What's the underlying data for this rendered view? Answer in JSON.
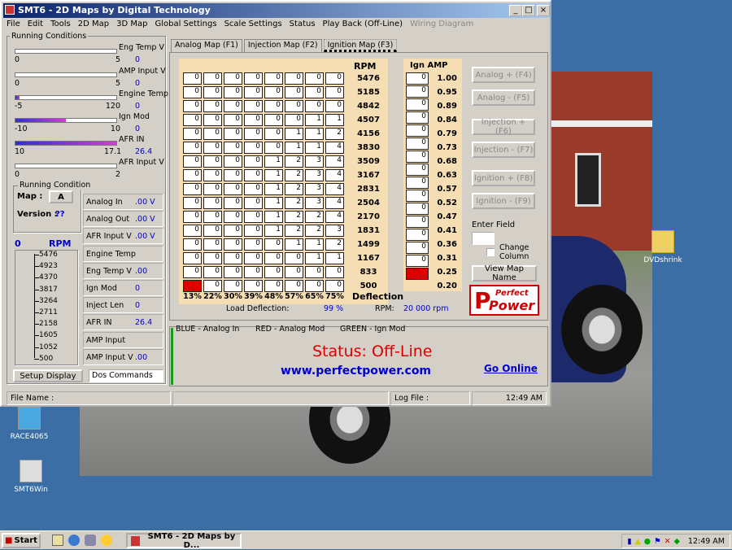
{
  "window": {
    "title": "SMT6 - 2D Maps  by Digital Technology"
  },
  "menu": [
    "File",
    "Edit",
    "Tools",
    "2D Map",
    "3D Map",
    "Global Settings",
    "Scale Settings",
    "Status",
    "Play Back (Off-Line)",
    "Wiring Diagram"
  ],
  "running_conditions": {
    "title": "Running Conditions",
    "gauges": [
      {
        "label": "Eng Temp V",
        "min": "0",
        "max": "5",
        "value": "0",
        "fill": 0
      },
      {
        "label": "AMP Input V",
        "min": "0",
        "max": "5",
        "value": "0",
        "fill": 0
      },
      {
        "label": "Engine Temp",
        "min": "-5",
        "max": "120",
        "value": "0",
        "fill": 0.04
      },
      {
        "label": "Ign Mod",
        "min": "-10",
        "max": "10",
        "value": "0",
        "fill": 0.5
      },
      {
        "label": "AFR IN",
        "min": "10",
        "max": "17.1",
        "value": "26.4",
        "fill": 1
      },
      {
        "label": "AFR Input V",
        "min": "0",
        "max": "2",
        "value": "",
        "fill": 0
      }
    ]
  },
  "running_condition": {
    "title": "Running Condition",
    "map_label": "Map :",
    "map_value": "A",
    "version_label": "Version :",
    "version_value": "??"
  },
  "readouts": [
    {
      "label": "Analog In",
      "value": ".00 V"
    },
    {
      "label": "Analog Out",
      "value": ".00 V"
    },
    {
      "label": "AFR Input V",
      "value": ".00 V"
    },
    {
      "label": "Engine Temp",
      "value": ""
    },
    {
      "label": "Eng Temp V",
      "value": ".00"
    },
    {
      "label": "Ign Mod",
      "value": "0"
    },
    {
      "label": "Inject Len",
      "value": "0"
    },
    {
      "label": "AFR IN",
      "value": "26.4"
    },
    {
      "label": "AMP Input",
      "value": ""
    },
    {
      "label": "AMP Input V",
      "value": ".00"
    }
  ],
  "rpm_gauge": {
    "value": "0",
    "label": "RPM",
    "ticks": [
      "5476",
      "4923",
      "4370",
      "3817",
      "3264",
      "2711",
      "2158",
      "1605",
      "1052",
      "500"
    ]
  },
  "setup_button": "Setup Display",
  "dos_commands": "Dos Commands",
  "tabs": [
    "Analog Map (F1)",
    "Injection Map (F2)",
    "Ignition Map (F3)"
  ],
  "map": {
    "rpm_header": "RPM",
    "amp_header": "Ign AMP",
    "rpm": [
      "5476",
      "5185",
      "4842",
      "4507",
      "4156",
      "3830",
      "3509",
      "3167",
      "2831",
      "2504",
      "2170",
      "1831",
      "1499",
      "1167",
      "833",
      "500"
    ],
    "amp": [
      "1.00",
      "0.95",
      "0.89",
      "0.84",
      "0.79",
      "0.73",
      "0.68",
      "0.63",
      "0.57",
      "0.52",
      "0.47",
      "0.41",
      "0.36",
      "0.31",
      "0.25",
      "0.20"
    ],
    "rows": [
      [
        0,
        0,
        0,
        0,
        0,
        0,
        0,
        0
      ],
      [
        0,
        0,
        0,
        0,
        0,
        0,
        0,
        0
      ],
      [
        0,
        0,
        0,
        0,
        0,
        0,
        0,
        0
      ],
      [
        0,
        0,
        0,
        0,
        0,
        0,
        1,
        1
      ],
      [
        0,
        0,
        0,
        0,
        0,
        1,
        1,
        2
      ],
      [
        0,
        0,
        0,
        0,
        0,
        1,
        1,
        4
      ],
      [
        0,
        0,
        0,
        0,
        1,
        2,
        3,
        4
      ],
      [
        0,
        0,
        0,
        0,
        1,
        2,
        3,
        4
      ],
      [
        0,
        0,
        0,
        0,
        1,
        2,
        3,
        4
      ],
      [
        0,
        0,
        0,
        0,
        1,
        2,
        3,
        4
      ],
      [
        0,
        0,
        0,
        0,
        1,
        2,
        2,
        4
      ],
      [
        0,
        0,
        0,
        0,
        1,
        2,
        2,
        3
      ],
      [
        0,
        0,
        0,
        0,
        0,
        1,
        1,
        2
      ],
      [
        0,
        0,
        0,
        0,
        0,
        0,
        1,
        1
      ],
      [
        0,
        0,
        0,
        0,
        0,
        0,
        0,
        0
      ],
      [
        1,
        0,
        0,
        0,
        0,
        0,
        0,
        0
      ]
    ],
    "amp_values": [
      "0",
      "0",
      "0",
      "0",
      "0",
      "0",
      "0",
      "0",
      "0",
      "0",
      "0",
      "0",
      "0",
      "0",
      "0",
      "0"
    ],
    "deflection": [
      "13%",
      "22%",
      "30%",
      "39%",
      "48%",
      "57%",
      "65%",
      "75%"
    ],
    "deflection_label": "Deflection",
    "load_deflection_label": "Load Deflection:",
    "load_deflection_value": "99 %",
    "rpm_label": "RPM:",
    "rpm_value": "20 000 rpm"
  },
  "side_buttons": [
    "Analog + (F4)",
    "Analog - (F5)",
    "Injection + (F6)",
    "Injection - (F7)",
    "Ignition + (F8)",
    "Ignition - (F9)"
  ],
  "enter_field": "Enter Field",
  "change_column": "Change Column",
  "view_map_name": "View Map Name",
  "logo": {
    "top": "Perfect",
    "bottom": "Power"
  },
  "legend": {
    "blue": "BLUE - Analog In",
    "red": "RED - Analog Mod",
    "green": "GREEN - Ign Mod"
  },
  "status": {
    "text": "Status: Off-Line",
    "url": "www.perfectpower.com",
    "go_online": "Go Online"
  },
  "statusbar": {
    "file": "File Name :",
    "log": "Log File :",
    "time": "12:49 AM"
  },
  "desktop": {
    "icons": [
      "DVDshrink",
      "RACE4065",
      "SMT6Win"
    ]
  },
  "taskbar": {
    "start": "Start",
    "task": "SMT6 - 2D Maps  by D...",
    "clock": "12:49 AM"
  },
  "colors": {
    "accent": "#0a246a",
    "link": "#0000cc",
    "status_red": "#dd0000"
  }
}
